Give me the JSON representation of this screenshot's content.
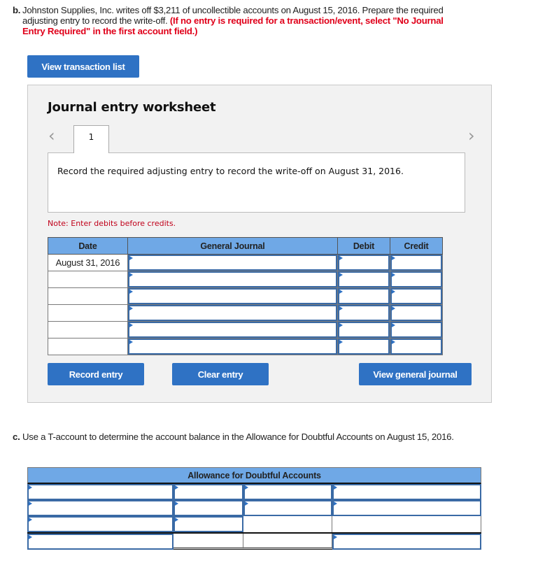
{
  "question_b": {
    "letter": "b.",
    "text": "Johnston Supplies, Inc. writes off $3,211 of uncollectible accounts on August 15, 2016. Prepare the required adjusting entry to record the write-off.",
    "hint": "(If no entry is required for a transaction/event, select \"No Journal Entry Required\" in the first account field.)"
  },
  "buttons": {
    "view_transaction_list": "View transaction list",
    "record_entry": "Record entry",
    "clear_entry": "Clear entry",
    "view_general_journal": "View general journal"
  },
  "worksheet": {
    "title": "Journal entry worksheet",
    "prev_icon": "chevron-left-icon",
    "next_icon": "chevron-right-icon",
    "prev_glyph": "‹",
    "next_glyph": "›",
    "active_tab": "1",
    "description": "Record the required adjusting entry to record the write-off on August 31, 2016.",
    "note": "Note: Enter debits before credits."
  },
  "journal_table": {
    "headers": [
      "Date",
      "General Journal",
      "Debit",
      "Credit"
    ],
    "rows": [
      {
        "date": "August 31, 2016",
        "account": "",
        "debit": "",
        "credit": ""
      },
      {
        "date": "",
        "account": "",
        "debit": "",
        "credit": ""
      },
      {
        "date": "",
        "account": "",
        "debit": "",
        "credit": ""
      },
      {
        "date": "",
        "account": "",
        "debit": "",
        "credit": ""
      },
      {
        "date": "",
        "account": "",
        "debit": "",
        "credit": ""
      },
      {
        "date": "",
        "account": "",
        "debit": "",
        "credit": ""
      }
    ]
  },
  "question_c": {
    "letter": "c.",
    "text": "Use a T-account to determine the account balance in the Allowance for Doubtful Accounts on August 15, 2016."
  },
  "t_account": {
    "title": "Allowance for Doubtful Accounts"
  },
  "colors": {
    "button_blue": "#2f72c4",
    "header_blue": "#6fa8e6",
    "hint_red": "#e0001a",
    "note_red": "#c0001a",
    "panel_gray": "#f2f2f2"
  }
}
